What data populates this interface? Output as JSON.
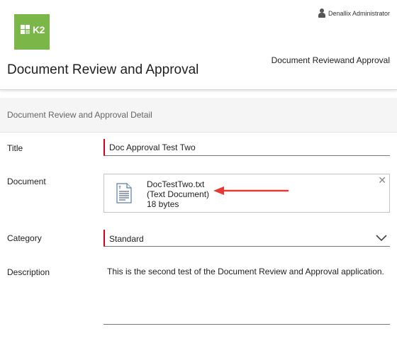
{
  "header": {
    "user_name": "Denallix Administrator",
    "logo_text": "K2",
    "page_title": "Document Review and Approval",
    "app_name": "Document Reviewand Approval"
  },
  "section": {
    "title": "Document Review and Approval Detail"
  },
  "form": {
    "title_label": "Title",
    "title_value": "Doc Approval Test Two",
    "document_label": "Document",
    "document": {
      "file_name": "DocTestTwo.txt",
      "file_type": "(Text Document)",
      "file_size": "18 bytes"
    },
    "category_label": "Category",
    "category_value": "Standard",
    "description_label": "Description",
    "description_value": "This is the second test of the Document Review and Approval application."
  },
  "colors": {
    "brand": "#7ab648",
    "required": "#d0021b",
    "annotation_arrow": "#e53935"
  },
  "icons": {
    "user": "user-icon",
    "document": "text-document-icon",
    "close": "close-icon",
    "dropdown": "chevron-down-icon"
  }
}
